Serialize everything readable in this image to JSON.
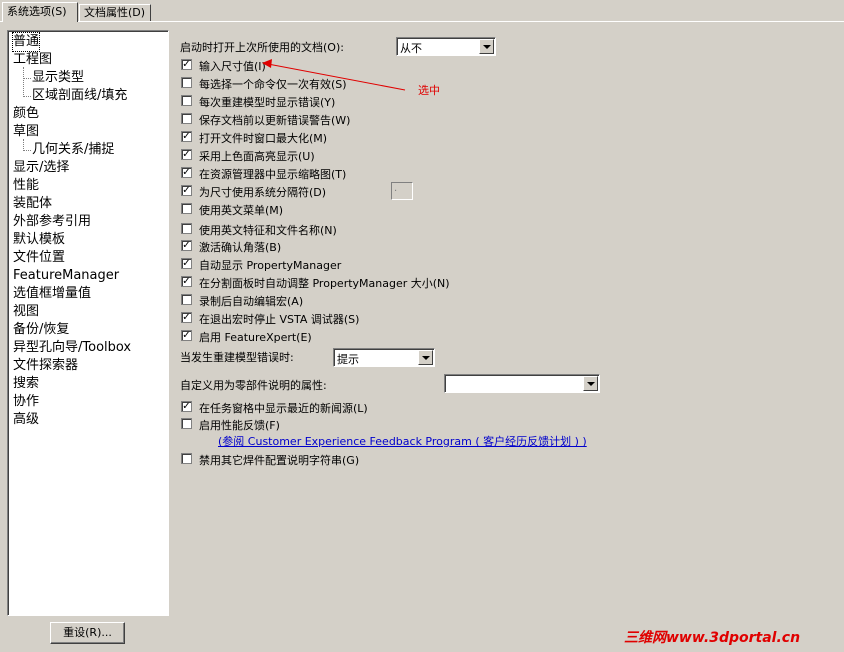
{
  "tabs": [
    {
      "label": "系统选项(S)"
    },
    {
      "label": "文档属性(D)"
    }
  ],
  "tree": {
    "items": [
      {
        "label": "普通",
        "level": 0,
        "selected": true
      },
      {
        "label": "工程图",
        "level": 0
      },
      {
        "label": "显示类型",
        "level": 1
      },
      {
        "label": "区域剖面线/填充",
        "level": 1
      },
      {
        "label": "颜色",
        "level": 0
      },
      {
        "label": "草图",
        "level": 0
      },
      {
        "label": "几何关系/捕捉",
        "level": 1
      },
      {
        "label": "显示/选择",
        "level": 0
      },
      {
        "label": "性能",
        "level": 0
      },
      {
        "label": "装配体",
        "level": 0
      },
      {
        "label": "外部参考引用",
        "level": 0
      },
      {
        "label": "默认模板",
        "level": 0
      },
      {
        "label": "文件位置",
        "level": 0
      },
      {
        "label": "FeatureManager",
        "level": 0
      },
      {
        "label": "选值框增量值",
        "level": 0
      },
      {
        "label": "视图",
        "level": 0
      },
      {
        "label": "备份/恢复",
        "level": 0
      },
      {
        "label": "异型孔向导/Toolbox",
        "level": 0
      },
      {
        "label": "文件探索器",
        "level": 0
      },
      {
        "label": "搜索",
        "level": 0
      },
      {
        "label": "协作",
        "level": 0
      },
      {
        "label": "高级",
        "level": 0
      }
    ]
  },
  "reset_button": "重设(R)...",
  "open_last_docs": {
    "label": "启动时打开上次所使用的文档(O):",
    "value": "从不"
  },
  "checkboxes": [
    {
      "label": "输入尺寸值(I)",
      "checked": true
    },
    {
      "label": "每选择一个命令仅一次有效(S)",
      "checked": false
    },
    {
      "label": "每次重建模型时显示错误(Y)",
      "checked": false
    },
    {
      "label": "保存文档前以更新错误警告(W)",
      "checked": false
    },
    {
      "label": "打开文件时窗口最大化(M)",
      "checked": true
    },
    {
      "label": "采用上色面高亮显示(U)",
      "checked": true
    },
    {
      "label": "在资源管理器中显示缩略图(T)",
      "checked": true
    },
    {
      "label": "为尺寸使用系统分隔符(D)",
      "checked": true
    },
    {
      "label": "使用英文菜单(M)",
      "checked": false
    },
    {
      "label": "使用英文特征和文件名称(N)",
      "checked": false
    },
    {
      "label": "激活确认角落(B)",
      "checked": true
    },
    {
      "label": "自动显示 PropertyManager",
      "checked": true
    },
    {
      "label": "在分割面板时自动调整 PropertyManager 大小(N)",
      "checked": true
    },
    {
      "label": "录制后自动编辑宏(A)",
      "checked": false
    },
    {
      "label": "在退出宏时停止 VSTA 调试器(S)",
      "checked": true
    },
    {
      "label": "启用 FeatureXpert(E)",
      "checked": true
    }
  ],
  "separator_value": ".",
  "rebuild_error": {
    "label": "当发生重建模型错误时:",
    "value": "提示"
  },
  "custom_property": {
    "label": "自定义用为零部件说明的属性:",
    "value": ""
  },
  "checkboxes2": [
    {
      "label": "在任务窗格中显示最近的新闻源(L)",
      "checked": true
    },
    {
      "label": "启用性能反馈(F)",
      "checked": false
    }
  ],
  "feedback_link": "(参阅 Customer Experience Feedback Program ( 客户经历反馈计划 ) )",
  "checkbox_last": {
    "label": "禁用其它焊件配置说明字符串(G)",
    "checked": false
  },
  "annotation": "选中",
  "watermark": "三维网www.3dportal.cn",
  "colors": {
    "annotation": "#e00000",
    "link": "#0000cc",
    "background": "#d4d0c8"
  }
}
